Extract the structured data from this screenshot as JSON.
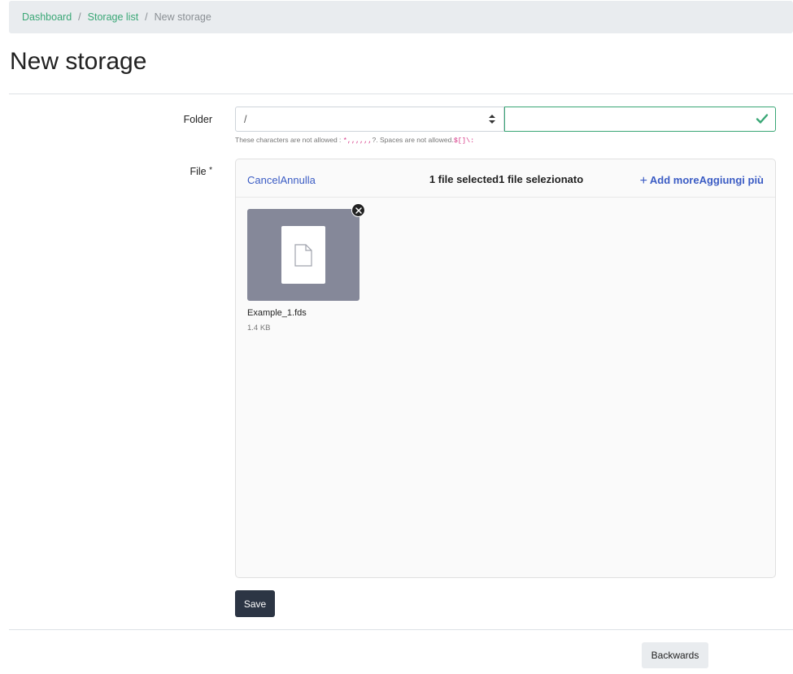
{
  "breadcrumb": {
    "items": [
      {
        "label": "Dashboard"
      },
      {
        "label": "Storage list"
      },
      {
        "label": "New storage"
      }
    ],
    "separator": "/"
  },
  "page": {
    "title": "New storage"
  },
  "form": {
    "folder": {
      "label": "Folder",
      "selected": "/",
      "input_value": "",
      "hint_text": "These characters are not allowed :",
      "hint_chars_1": "*,,,,,,",
      "hint_mid": "?. Spaces are not allowed.",
      "hint_chars_2": "$[]\\:"
    },
    "file": {
      "label": "File",
      "required_mark": "*"
    }
  },
  "uploader": {
    "cancel_label": "CancelAnnulla",
    "selected_count": "1 file selected1 file selezionato",
    "add_more_label": "Add moreAggiungi più",
    "files": [
      {
        "name": "Example_1.fds",
        "size": "1.4 KB"
      }
    ]
  },
  "buttons": {
    "save": "Save",
    "back": "Backwards"
  },
  "colors": {
    "accent": "#3aa776",
    "link_blue": "#3b5cc4",
    "dark_button": "#2c3544",
    "thumb_bg": "#858899"
  },
  "icons": {
    "select_arrows": "sort-arrows-icon",
    "valid_check": "check-icon",
    "add": "plus-icon",
    "remove": "close-icon",
    "file": "file-icon"
  }
}
